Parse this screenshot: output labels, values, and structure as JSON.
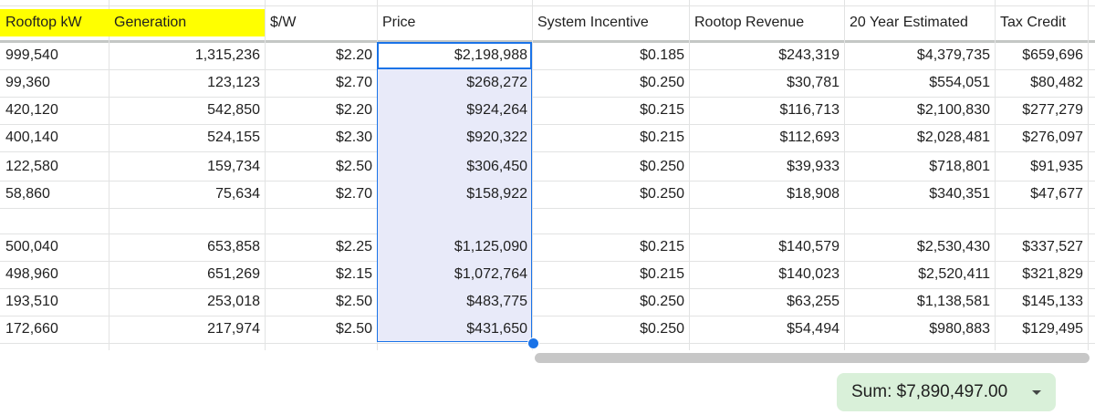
{
  "headers": [
    {
      "label": "Rooftop kW",
      "yellow": true
    },
    {
      "label": "Generation",
      "yellow": true
    },
    {
      "label": "$/W",
      "yellow": false
    },
    {
      "label": "Price",
      "yellow": false
    },
    {
      "label": "System Incentive",
      "yellow": false
    },
    {
      "label": "Rootop Revenue",
      "yellow": false
    },
    {
      "label": "20 Year Estimated",
      "yellow": false
    },
    {
      "label": "Tax Credit",
      "yellow": false
    }
  ],
  "rows": [
    [
      "999,540",
      "1,315,236",
      "$2.20",
      "$2,198,988",
      "$0.185",
      "$243,319",
      "$4,379,735",
      "$659,696"
    ],
    [
      "99,360",
      "123,123",
      "$2.70",
      "$268,272",
      "$0.250",
      "$30,781",
      "$554,051",
      "$80,482"
    ],
    [
      "420,120",
      "542,850",
      "$2.20",
      "$924,264",
      "$0.215",
      "$116,713",
      "$2,100,830",
      "$277,279"
    ],
    [
      "400,140",
      "524,155",
      "$2.30",
      "$920,322",
      "$0.215",
      "$112,693",
      "$2,028,481",
      "$276,097"
    ],
    [
      "122,580",
      "159,734",
      "$2.50",
      "$306,450",
      "$0.250",
      "$39,933",
      "$718,801",
      "$91,935"
    ],
    [
      "58,860",
      "75,634",
      "$2.70",
      "$158,922",
      "$0.250",
      "$18,908",
      "$340,351",
      "$47,677"
    ],
    [
      "",
      "",
      "",
      "",
      "",
      "",
      "",
      ""
    ],
    [
      "500,040",
      "653,858",
      "$2.25",
      "$1,125,090",
      "$0.215",
      "$140,579",
      "$2,530,430",
      "$337,527"
    ],
    [
      "498,960",
      "651,269",
      "$2.15",
      "$1,072,764",
      "$0.215",
      "$140,023",
      "$2,520,411",
      "$321,829"
    ],
    [
      "193,510",
      "253,018",
      "$2.50",
      "$483,775",
      "$0.250",
      "$63,255",
      "$1,138,581",
      "$145,133"
    ],
    [
      "172,660",
      "217,974",
      "$2.50",
      "$431,650",
      "$0.250",
      "$54,494",
      "$980,883",
      "$129,495"
    ]
  ],
  "status": {
    "sum_label": "Sum: $7,890,497.00"
  }
}
